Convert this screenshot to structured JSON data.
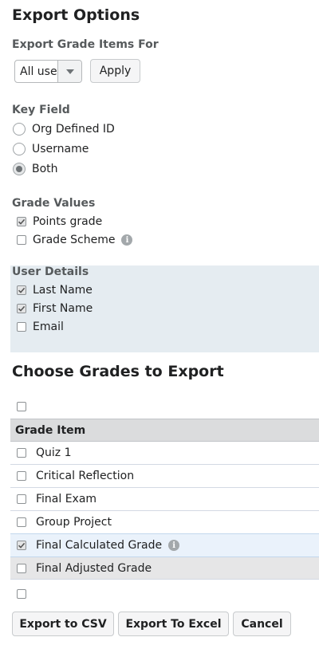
{
  "page_title": "Export Options",
  "export_for": {
    "label": "Export Grade Items For",
    "select_value": "All users",
    "apply_label": "Apply"
  },
  "key_field": {
    "label": "Key Field",
    "options": [
      {
        "label": "Org Defined ID",
        "selected": false
      },
      {
        "label": "Username",
        "selected": false
      },
      {
        "label": "Both",
        "selected": true
      }
    ]
  },
  "grade_values": {
    "label": "Grade Values",
    "items": [
      {
        "label": "Points grade",
        "checked": true
      },
      {
        "label": "Grade Scheme",
        "checked": false,
        "info": true
      }
    ]
  },
  "user_details": {
    "label": "User Details",
    "items": [
      {
        "label": "Last Name",
        "checked": true
      },
      {
        "label": "First Name",
        "checked": true
      },
      {
        "label": "Email",
        "checked": false
      }
    ]
  },
  "choose_grades": {
    "title": "Choose Grades to Export",
    "column_header": "Grade Item",
    "rows": [
      {
        "label": "Quiz 1",
        "checked": false
      },
      {
        "label": "Critical Reflection",
        "checked": false
      },
      {
        "label": "Final Exam",
        "checked": false
      },
      {
        "label": "Group Project",
        "checked": false
      },
      {
        "label": "Final Calculated Grade",
        "checked": true,
        "info": true
      },
      {
        "label": "Final Adjusted Grade",
        "checked": false
      }
    ]
  },
  "buttons": {
    "csv": "Export to CSV",
    "excel": "Export To Excel",
    "cancel": "Cancel"
  },
  "icons": {
    "dropdown": "chevron-down-icon",
    "info": "info-icon",
    "check": "check-icon"
  }
}
